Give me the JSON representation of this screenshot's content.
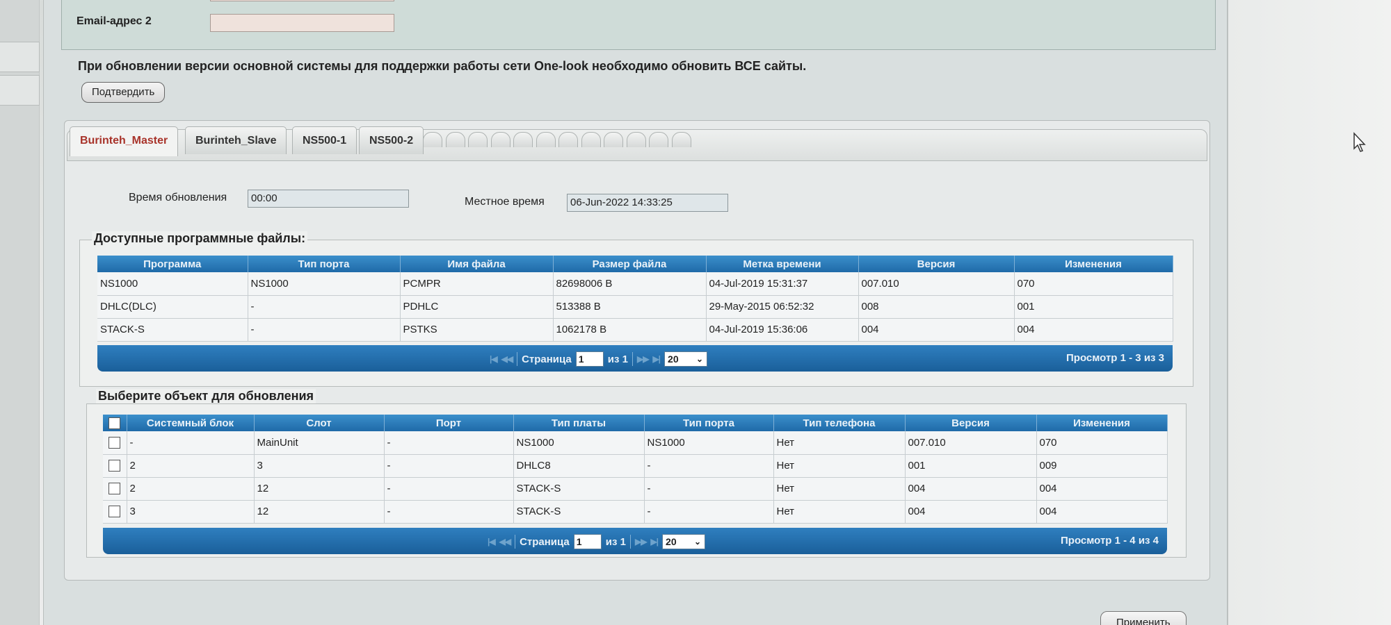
{
  "email": {
    "label": "Email-адрес 2",
    "value": ""
  },
  "notice": "При обновлении версии основной системы для поддержки работы сети One-look необходимо обновить ВСЕ сайты.",
  "confirm_label": "Подтвердить",
  "tabs": [
    {
      "label": "Burinteh_Master",
      "active": true
    },
    {
      "label": "Burinteh_Slave",
      "active": false
    },
    {
      "label": "NS500-1",
      "active": false
    },
    {
      "label": "NS500-2",
      "active": false
    }
  ],
  "update_time": {
    "label": "Время обновления",
    "value": "00:00"
  },
  "local_time": {
    "label": "Местное время",
    "value": "06-Jun-2022 14:33:25"
  },
  "files": {
    "legend": "Доступные программные файлы:",
    "columns": [
      "Программа",
      "Тип порта",
      "Имя файла",
      "Размер файла",
      "Метка времени",
      "Версия",
      "Изменения"
    ],
    "rows": [
      [
        "NS1000",
        "NS1000",
        "PCMPR",
        "82698006 B",
        "04-Jul-2019 15:31:37",
        "007.010",
        "070"
      ],
      [
        "DHLC(DLC)",
        "-",
        "PDHLC",
        "513388 B",
        "29-May-2015 06:52:32",
        "008",
        "001"
      ],
      [
        "STACK-S",
        "-",
        "PSTKS",
        "1062178 B",
        "04-Jul-2019 15:36:06",
        "004",
        "004"
      ]
    ],
    "pager": {
      "page_label": "Страница",
      "page": "1",
      "of_label": "из 1",
      "per_page": "20",
      "view": "Просмотр 1 - 3 из 3"
    }
  },
  "targets": {
    "legend": "Выберите объект для обновления",
    "columns": [
      "Системный блок",
      "Слот",
      "Порт",
      "Тип платы",
      "Тип порта",
      "Тип телефона",
      "Версия",
      "Изменения"
    ],
    "rows": [
      [
        "-",
        "MainUnit",
        "-",
        "NS1000",
        "NS1000",
        "Нет",
        "007.010",
        "070"
      ],
      [
        "2",
        "3",
        "-",
        "DHLC8",
        "-",
        "Нет",
        "001",
        "009"
      ],
      [
        "2",
        "12",
        "-",
        "STACK-S",
        "-",
        "Нет",
        "004",
        "004"
      ],
      [
        "3",
        "12",
        "-",
        "STACK-S",
        "-",
        "Нет",
        "004",
        "004"
      ]
    ],
    "pager": {
      "page_label": "Страница",
      "page": "1",
      "of_label": "из 1",
      "per_page": "20",
      "view": "Просмотр 1 - 4 из 4"
    }
  },
  "apply_label": "Применить"
}
